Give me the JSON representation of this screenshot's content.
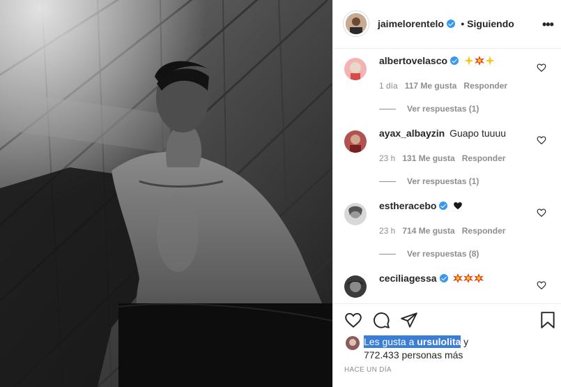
{
  "post": {
    "author": "jaimelorentelo",
    "follow_status": "• Siguiendo",
    "more_icon": "more-dots-icon",
    "photo": "black-and-white photo of shirtless man against wooden wall"
  },
  "comments": [
    {
      "username": "albertovelasco",
      "verified": true,
      "text": "",
      "emoji": [
        "sparkles",
        "collision",
        "sparkles"
      ],
      "time": "1 día",
      "likes": "117 Me gusta",
      "reply": "Responder",
      "view_replies": "Ver respuestas (1)"
    },
    {
      "username": "ayax_albayzin",
      "verified": false,
      "text": "Guapo tuuuu",
      "emoji": [],
      "time": "23 h",
      "likes": "131 Me gusta",
      "reply": "Responder",
      "view_replies": "Ver respuestas (1)"
    },
    {
      "username": "estheracebo",
      "verified": true,
      "text": "",
      "emoji": [
        "black-heart"
      ],
      "time": "23 h",
      "likes": "714 Me gusta",
      "reply": "Responder",
      "view_replies": "Ver respuestas (8)"
    },
    {
      "username": "ceciliagessa",
      "verified": true,
      "text": "",
      "emoji": [
        "collision",
        "collision",
        "collision"
      ],
      "time": "",
      "likes": "",
      "reply": "",
      "view_replies": ""
    }
  ],
  "actions": {
    "like_icon": "heart-icon",
    "comment_icon": "comment-icon",
    "share_icon": "send-icon",
    "save_icon": "bookmark-icon"
  },
  "likes": {
    "prefix": "Les gusta a ",
    "user": "ursulolita",
    "suffix": " y",
    "count_line": "772.433 personas más"
  },
  "time_ago": "HACE UN DÍA",
  "colors": {
    "verified": "#3897f0",
    "selection": "#3b7ed6",
    "muted": "#8e8e8e"
  }
}
